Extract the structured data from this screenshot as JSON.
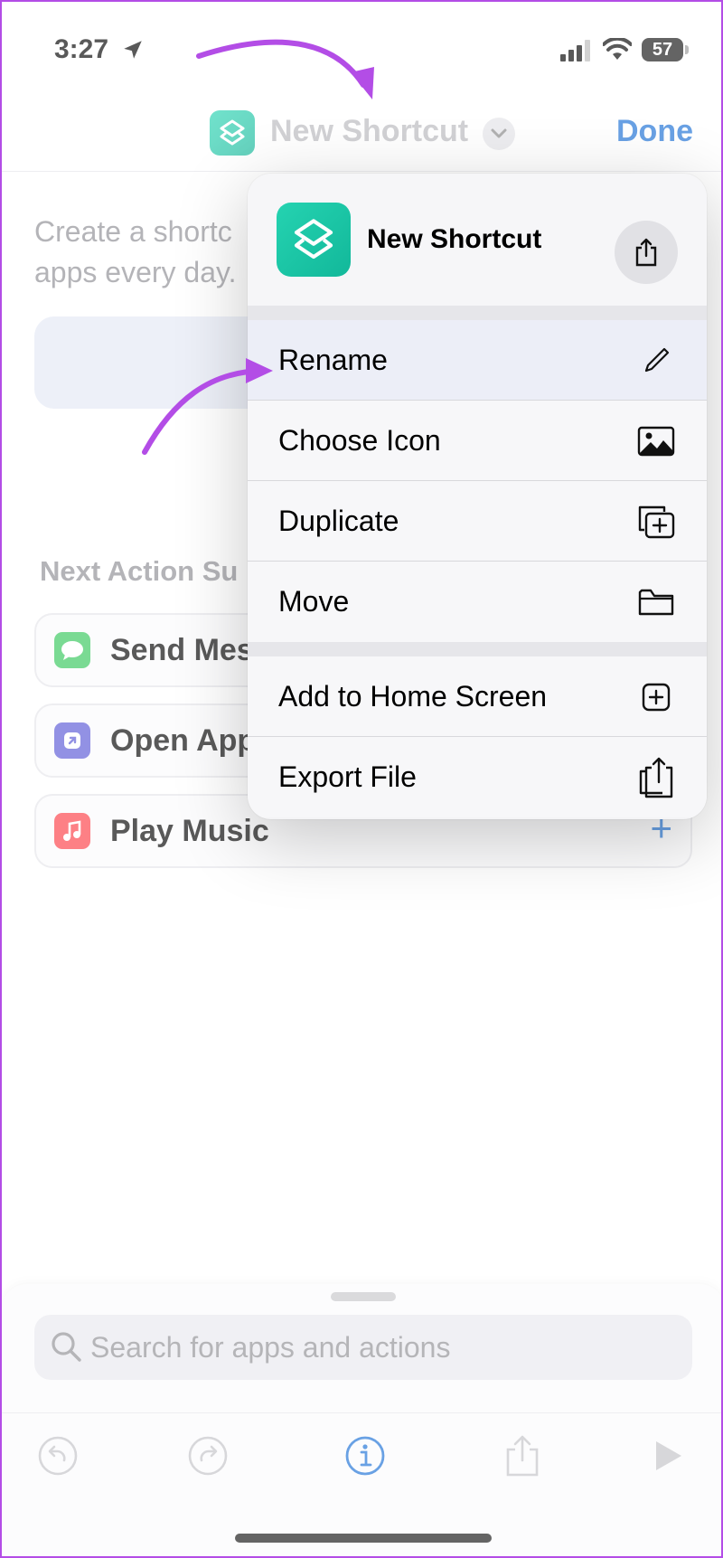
{
  "status_bar": {
    "time": "3:27",
    "battery": "57"
  },
  "nav": {
    "title": "New Shortcut",
    "done_label": "Done"
  },
  "content": {
    "intro_line1": "Create a shortc",
    "intro_line2": "apps every day.",
    "next_heading": "Next Action Su",
    "suggestions": [
      {
        "label": "Send Mes",
        "icon": "messages-icon",
        "color": "#34c759"
      },
      {
        "label": "Open App",
        "icon": "open-app-icon",
        "color": "#5856d6"
      },
      {
        "label": "Play Music",
        "icon": "music-icon",
        "color": "#fc3c44",
        "plus": "+"
      }
    ]
  },
  "menu": {
    "title": "New Shortcut",
    "items": [
      {
        "label": "Rename",
        "icon": "pencil-icon"
      },
      {
        "label": "Choose Icon",
        "icon": "image-icon"
      },
      {
        "label": "Duplicate",
        "icon": "duplicate-icon"
      },
      {
        "label": "Move",
        "icon": "folder-icon"
      },
      {
        "label": "Add to Home Screen",
        "icon": "add-square-icon"
      },
      {
        "label": "Export File",
        "icon": "export-file-icon"
      }
    ]
  },
  "search": {
    "placeholder": "Search for apps and actions"
  },
  "colors": {
    "accent": "#1a6fd6",
    "shortcut_teal": "#1ec8a8",
    "annotation": "#b34de6"
  }
}
